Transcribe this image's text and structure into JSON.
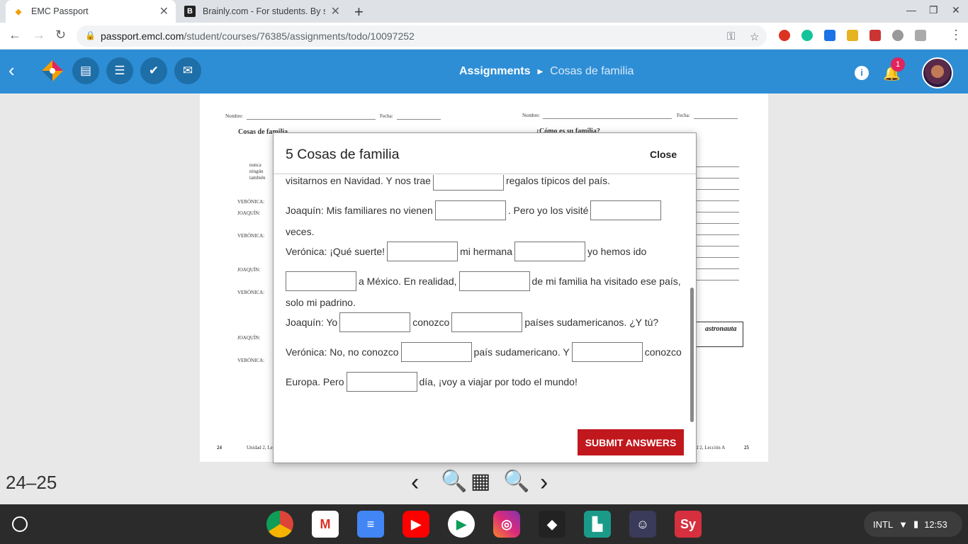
{
  "browser": {
    "tabs": [
      {
        "title": "EMC Passport",
        "active": true
      },
      {
        "title": "Brainly.com - For students. By st",
        "active": false
      }
    ],
    "url_host": "passport.emcl.com",
    "url_path": "/student/courses/76385/assignments/todo/10097252"
  },
  "header": {
    "breadcrumb_root": "Assignments",
    "breadcrumb_current": "Cosas de familia",
    "notification_count": "1"
  },
  "worksheet": {
    "left_title": "Cosas de familia",
    "right_title": "¿Cómo es su familia?",
    "name_label": "Nombre:",
    "date_label": "Fecha:",
    "word_list": [
      "nunca",
      "ningún",
      "también"
    ],
    "speakers": [
      "VERÓNICA:",
      "JOAQUÍN:",
      "VERÓNICA:",
      "JOAQUÍN:",
      "VERÓNICA:",
      "JOAQUÍN:",
      "VERÓNICA:"
    ],
    "astronauta": "astronauta",
    "page_left": "24",
    "page_right": "25",
    "footer_left": "Unidad 2, Lecci",
    "footer_right": "d 2, Lección A"
  },
  "modal": {
    "title": "5 Cosas de familia",
    "close_label": "Close",
    "lines": {
      "l1a": "visitarnos en Navidad. Y nos trae",
      "l1b": "regalos típicos del país.",
      "l2a": "Joaquín: Mis familiares no vienen",
      "l2b": ". Pero yo los visité",
      "l3": "veces.",
      "l4a": "Verónica: ¡Qué suerte!",
      "l4b": "mi hermana",
      "l4c": "yo hemos ido",
      "l5a": "a México. En realidad,",
      "l5b": "de mi familia ha visitado ese país,",
      "l6": "solo mi padrino.",
      "l7a": "Joaquín: Yo",
      "l7b": "conozco",
      "l7c": "países sudamericanos. ¿Y tú?",
      "l8a": "Verónica: No, no conozco",
      "l8b": "país sudamericano. Y",
      "l8c": "conozco",
      "l9a": "Europa. Pero",
      "l9b": "día, ¡voy a viajar por todo el mundo!"
    },
    "submit_label": "SUBMIT ANSWERS"
  },
  "viewer": {
    "page_range": "24–25"
  },
  "shelf": {
    "keyboard": "INTL",
    "time": "12:53"
  },
  "colors": {
    "header_blue": "#2d8ed6",
    "submit_red": "#c0181d"
  }
}
